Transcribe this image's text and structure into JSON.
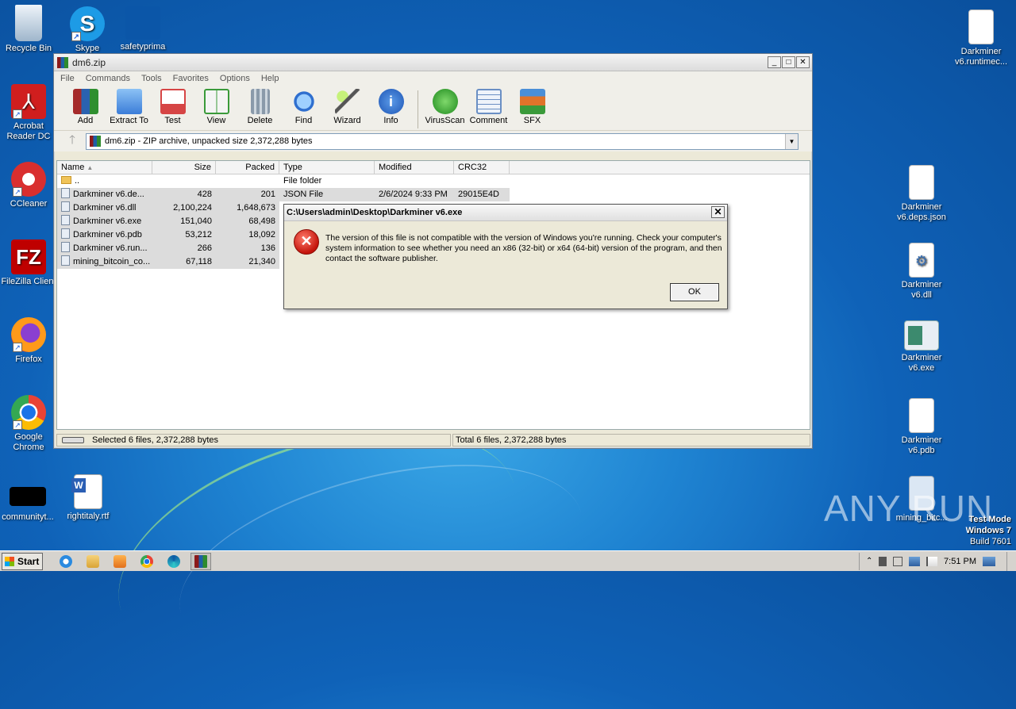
{
  "desktop": {
    "icons_left": [
      {
        "label": "Recycle Bin",
        "icon": "recycle-bin-icon"
      },
      {
        "label": "Skype",
        "icon": "skype-icon"
      },
      {
        "label": "safetyprima",
        "icon": "file-icon"
      },
      {
        "label": "Acrobat Reader DC",
        "icon": "acrobat-icon"
      },
      {
        "label": "CCleaner",
        "icon": "ccleaner-icon"
      },
      {
        "label": "FileZilla Client",
        "icon": "filezilla-icon"
      },
      {
        "label": "Firefox",
        "icon": "firefox-icon"
      },
      {
        "label": "Google Chrome",
        "icon": "chrome-icon"
      },
      {
        "label": "communityt...",
        "icon": "file-icon"
      },
      {
        "label": "rightitaly.rtf",
        "icon": "word-doc-icon"
      }
    ],
    "icons_right": [
      {
        "label": "Darkminer v6.runtimec...",
        "icon": "file-icon"
      },
      {
        "label": "Darkminer v6.deps.json",
        "icon": "file-icon"
      },
      {
        "label": "Darkminer v6.dll",
        "icon": "dll-icon"
      },
      {
        "label": "Darkminer v6.exe",
        "icon": "exe-icon"
      },
      {
        "label": "Darkminer v6.pdb",
        "icon": "file-icon"
      },
      {
        "label": "mining_bitc...",
        "icon": "file-icon"
      }
    ],
    "watermark": "ANY RUN",
    "test_mode": {
      "line1": "Test Mode",
      "line2": "Windows 7",
      "line3": "Build 7601"
    }
  },
  "winrar": {
    "title": "dm6.zip",
    "menu": [
      "File",
      "Commands",
      "Tools",
      "Favorites",
      "Options",
      "Help"
    ],
    "toolbar": [
      {
        "label": "Add",
        "icon": "add-archive-icon",
        "color": "#c0392b"
      },
      {
        "label": "Extract To",
        "icon": "extract-folder-icon",
        "color": "#3b7dd8"
      },
      {
        "label": "Test",
        "icon": "test-clipboard-icon",
        "color": "#d64545"
      },
      {
        "label": "View",
        "icon": "view-book-icon",
        "color": "#3a9a3a"
      },
      {
        "label": "Delete",
        "icon": "delete-trash-icon",
        "color": "#8a9aaa"
      },
      {
        "label": "Find",
        "icon": "find-magnifier-icon",
        "color": "#2f6fcf"
      },
      {
        "label": "Wizard",
        "icon": "wizard-wand-icon",
        "color": "#7bc043"
      },
      {
        "label": "Info",
        "icon": "info-icon",
        "color": "#2e6fd0"
      },
      {
        "label": "VirusScan",
        "icon": "virusscan-icon",
        "color": "#2aa02a"
      },
      {
        "label": "Comment",
        "icon": "comment-icon",
        "color": "#6a8fc4"
      },
      {
        "label": "SFX",
        "icon": "sfx-box-icon",
        "color": "#e0732a"
      }
    ],
    "address": "dm6.zip - ZIP archive, unpacked size 2,372,288 bytes",
    "columns": [
      "Name",
      "Size",
      "Packed",
      "Type",
      "Modified",
      "CRC32"
    ],
    "rows": [
      {
        "name": "..",
        "size": "",
        "packed": "",
        "type": "File folder",
        "modified": "",
        "crc": "",
        "folder": true
      },
      {
        "name": "Darkminer v6.de...",
        "size": "428",
        "packed": "201",
        "type": "JSON File",
        "modified": "2/6/2024 9:33 PM",
        "crc": "29015E4D"
      },
      {
        "name": "Darkminer v6.dll",
        "size": "2,100,224",
        "packed": "1,648,673",
        "type": "",
        "modified": "",
        "crc": ""
      },
      {
        "name": "Darkminer v6.exe",
        "size": "151,040",
        "packed": "68,498",
        "type": "",
        "modified": "",
        "crc": ""
      },
      {
        "name": "Darkminer v6.pdb",
        "size": "53,212",
        "packed": "18,092",
        "type": "",
        "modified": "",
        "crc": ""
      },
      {
        "name": "Darkminer v6.run...",
        "size": "266",
        "packed": "136",
        "type": "",
        "modified": "",
        "crc": ""
      },
      {
        "name": "mining_bitcoin_co...",
        "size": "67,118",
        "packed": "21,340",
        "type": "",
        "modified": "",
        "crc": ""
      }
    ],
    "status_left": "Selected 6 files, 2,372,288 bytes",
    "status_right": "Total 6 files, 2,372,288 bytes"
  },
  "dialog": {
    "title": "C:\\Users\\admin\\Desktop\\Darkminer v6.exe",
    "message": "The version of this file is not compatible with the version of Windows you're running. Check your computer's system information to see whether you need an x86 (32-bit) or x64 (64-bit) version of the program, and then contact the software publisher.",
    "ok": "OK"
  },
  "taskbar": {
    "start": "Start",
    "apps": [
      "ie-icon",
      "explorer-icon",
      "media-player-icon",
      "chrome-icon",
      "edge-icon",
      "winrar-icon"
    ],
    "clock": "7:51 PM"
  }
}
